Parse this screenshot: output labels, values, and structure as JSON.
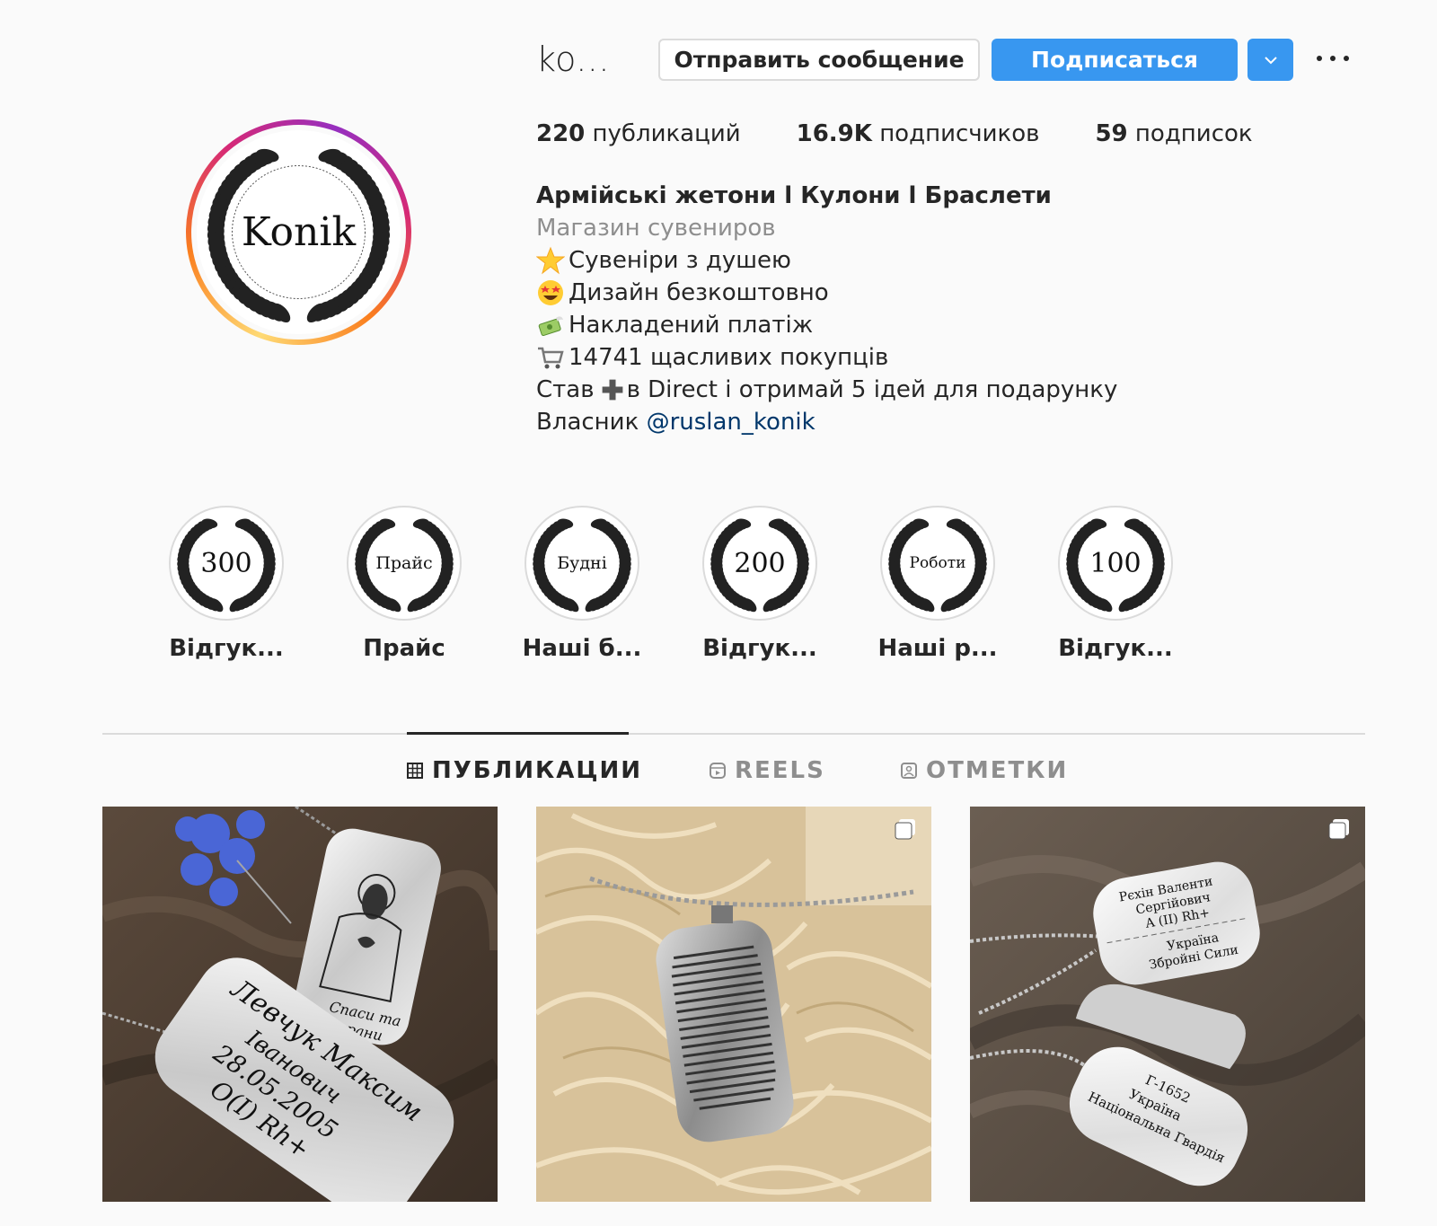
{
  "header": {
    "username": "ko...",
    "message_button": "Отправить сообщение",
    "follow_button": "Подписаться"
  },
  "avatar": {
    "text": "Konik"
  },
  "stats": [
    {
      "value": "220",
      "label": "публикаций"
    },
    {
      "value": "16.9K",
      "label": "подписчиков"
    },
    {
      "value": "59",
      "label": "подписок"
    }
  ],
  "bio": {
    "name": "Армійські жетони l Кулони l Браслети",
    "category": "Магазин сувениров",
    "lines": [
      "Сувеніри з душею",
      "Дизайн безкоштовно",
      "Накладений платіж",
      "14741 щасливих покупців"
    ],
    "direct_line_a": "Став",
    "direct_line_b": "в Direct і отримай 5 ідей для подарунку",
    "owner_prefix": "Власник",
    "owner_mention": "@ruslan_konik"
  },
  "highlights": [
    {
      "cover": "300",
      "label": "Відгук..."
    },
    {
      "cover": "Прайс",
      "label": "Прайс"
    },
    {
      "cover": "Будні",
      "label": "Наші б..."
    },
    {
      "cover": "200",
      "label": "Відгук..."
    },
    {
      "cover": "Роботи",
      "label": "Наші р..."
    },
    {
      "cover": "100",
      "label": "Відгук..."
    }
  ],
  "tabs": [
    {
      "label": "ПУБЛИКАЦИИ",
      "icon": "grid-icon",
      "active": true
    },
    {
      "label": "REELS",
      "icon": "reels-icon",
      "active": false
    },
    {
      "label": "ОТМЕТКИ",
      "icon": "tagged-icon",
      "active": false
    }
  ],
  "posts": [
    {
      "texts": [
        "Спаси та",
        "охрани",
        "Левчук Максим",
        "Іванович",
        "28.05.2005",
        "O(I) Rh+"
      ]
    },
    {
      "texts": [],
      "carousel": true
    },
    {
      "texts": [
        "Рєхін Валенти",
        "Сергійович",
        "A (II) Rh+",
        "Україна",
        "Збройні Сили",
        "Г-1652",
        "Україна",
        "Національна Гвардія"
      ],
      "carousel": true
    }
  ],
  "colors": {
    "accent": "#3897f0",
    "text": "#262626",
    "muted": "#8e8e8e",
    "link": "#00376b",
    "border": "#dbdbdb"
  }
}
